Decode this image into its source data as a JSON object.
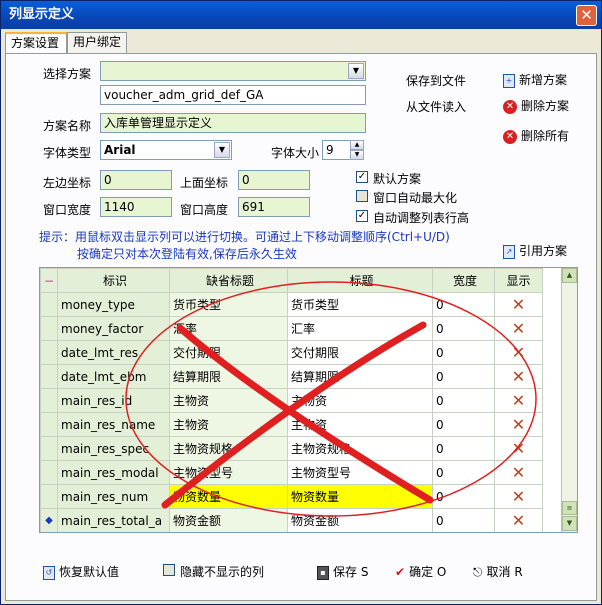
{
  "window": {
    "title": "列显示定义",
    "close_label": "✕"
  },
  "tabs": [
    {
      "label": "方案设置"
    },
    {
      "label": "用户绑定"
    }
  ],
  "form": {
    "scheme_label": "选择方案",
    "scheme_value": "",
    "scheme_id": "voucher_adm_grid_def_GA",
    "scheme_name_label": "方案名称",
    "scheme_name_value": "入库单管理显示定义",
    "font_type_label": "字体类型",
    "font_type_value": "Arial",
    "font_size_label": "字体大小",
    "font_size_value": "9",
    "left_label": "左边坐标",
    "left_value": "0",
    "top_label": "上面坐标",
    "top_value": "0",
    "width_label": "窗口宽度",
    "width_value": "1140",
    "height_label": "窗口高度",
    "height_value": "691"
  },
  "options": {
    "default_scheme": {
      "label": "默认方案",
      "checked": "✓"
    },
    "auto_max": {
      "label": "窗口自动最大化",
      "checked": ""
    },
    "auto_row_height": {
      "label": "自动调整列表行高",
      "checked": "✓"
    }
  },
  "actions": {
    "save_to_file": "保存到文件",
    "read_from_file": "从文件读入",
    "new_scheme": "新增方案",
    "delete_scheme": "删除方案",
    "delete_all": "删除所有",
    "reference_scheme": "引用方案"
  },
  "hint": {
    "line1": "提示：用鼠标双击显示列可以进行切换。可通过上下移动调整顺序(Ctrl+U/D)",
    "line2": "按确定只对本次登陆有效,保存后永久生效"
  },
  "grid": {
    "headers": {
      "marker": "−",
      "id": "标识",
      "default_title": "缺省标题",
      "title": "标题",
      "width": "宽度",
      "show": "显示"
    },
    "rows": [
      {
        "id": "money_type",
        "default_title": "货币类型",
        "title": "货币类型",
        "width": "0",
        "show": "✕"
      },
      {
        "id": "money_factor",
        "default_title": "汇率",
        "title": "汇率",
        "width": "0",
        "show": "✕"
      },
      {
        "id": "date_lmt_res",
        "default_title": "交付期限",
        "title": "交付期限",
        "width": "0",
        "show": "✕"
      },
      {
        "id": "date_lmt_ebm",
        "default_title": "结算期限",
        "title": "结算期限",
        "width": "0",
        "show": "✕"
      },
      {
        "id": "main_res_id",
        "default_title": "主物资",
        "title": "主物资",
        "width": "0",
        "show": "✕"
      },
      {
        "id": "main_res_name",
        "default_title": "主物资",
        "title": "主物资",
        "width": "0",
        "show": "✕"
      },
      {
        "id": "main_res_spec",
        "default_title": "主物资规格",
        "title": "主物资规格",
        "width": "0",
        "show": "✕"
      },
      {
        "id": "main_res_modal",
        "default_title": "主物资型号",
        "title": "主物资型号",
        "width": "0",
        "show": "✕"
      },
      {
        "id": "main_res_num",
        "default_title": "物资数量",
        "title": "物资数量",
        "width": "0",
        "show": "✕"
      },
      {
        "id": "main_res_total_a",
        "default_title": "物资金额",
        "title": "物资金额",
        "width": "0",
        "show": "✕",
        "marker": "◆"
      }
    ]
  },
  "bottom": {
    "restore_default": "恢复默认值",
    "hide_hidden": "隐藏不显示的列",
    "save": "保存 S",
    "ok": "确定 O",
    "cancel": "取消 R"
  },
  "colors": {
    "accent_yellow": "#ffff00",
    "annotation_red": "#e02020",
    "grid_green": "#e3efd6"
  }
}
